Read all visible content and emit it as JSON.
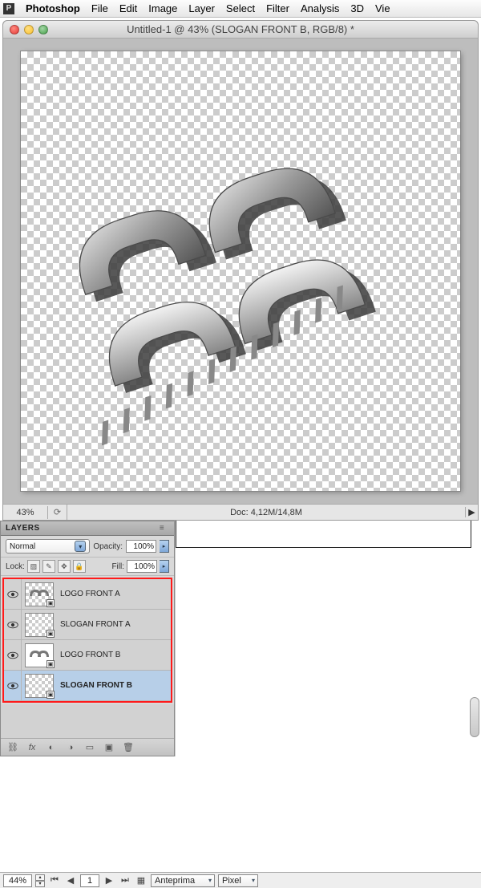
{
  "menubar": {
    "app_name": "Photoshop",
    "items": [
      "File",
      "Edit",
      "Image",
      "Layer",
      "Select",
      "Filter",
      "Analysis",
      "3D",
      "Vie"
    ]
  },
  "window": {
    "title": "Untitled-1 @ 43% (SLOGAN FRONT B, RGB/8) *"
  },
  "status": {
    "zoom": "43%",
    "doc_info": "Doc: 4,12M/14,8M"
  },
  "layers_panel": {
    "tab": "LAYERS",
    "blend_mode": "Normal",
    "opacity_label": "Opacity:",
    "opacity_value": "100%",
    "lock_label": "Lock:",
    "fill_label": "Fill:",
    "fill_value": "100%",
    "items": [
      {
        "name": "LOGO FRONT A",
        "selected": false,
        "solid_thumb": false,
        "has_content": true
      },
      {
        "name": "SLOGAN FRONT A",
        "selected": false,
        "solid_thumb": false,
        "has_content": false
      },
      {
        "name": "LOGO FRONT B",
        "selected": false,
        "solid_thumb": true,
        "has_content": true
      },
      {
        "name": "SLOGAN FRONT B",
        "selected": true,
        "solid_thumb": false,
        "has_content": false
      }
    ]
  },
  "bottom_bar": {
    "zoom": "44%",
    "page": "1",
    "preview_label": "Anteprima",
    "units": "Pixel"
  }
}
